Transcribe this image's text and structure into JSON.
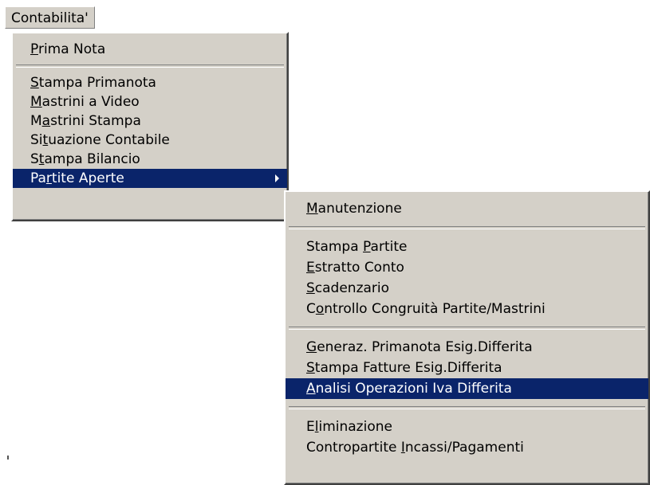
{
  "menubar": {
    "title": "Contabilita'"
  },
  "menu_main": {
    "items": [
      {
        "pre": "",
        "key": "P",
        "post": "rima Nota"
      },
      {
        "pre": "",
        "key": "S",
        "post": "tampa Primanota"
      },
      {
        "pre": "",
        "key": "M",
        "post": "astrini a Video"
      },
      {
        "pre": "M",
        "key": "a",
        "post": "strini Stampa"
      },
      {
        "pre": "Si",
        "key": "t",
        "post": "uazione Contabile"
      },
      {
        "pre": "S",
        "key": "t",
        "post": "ampa Bilancio"
      },
      {
        "pre": "Pa",
        "key": "r",
        "post": "tite Aperte"
      }
    ]
  },
  "submenu_partite": {
    "items": [
      {
        "pre": "",
        "key": "M",
        "post": "anutenzione"
      },
      {
        "pre": "Stampa ",
        "key": "P",
        "post": "artite"
      },
      {
        "pre": "",
        "key": "E",
        "post": "stratto Conto"
      },
      {
        "pre": "",
        "key": "S",
        "post": "cadenzario"
      },
      {
        "pre": "C",
        "key": "o",
        "post": "ntrollo Congruità Partite/Mastrini"
      },
      {
        "pre": "",
        "key": "G",
        "post": "eneraz. Primanota Esig.Differita"
      },
      {
        "pre": "",
        "key": "S",
        "post": "tampa Fatture Esig.Differita"
      },
      {
        "pre": "",
        "key": "A",
        "post": "nalisi Operazioni Iva Differita"
      },
      {
        "pre": "E",
        "key": "l",
        "post": "iminazione"
      },
      {
        "pre": "Contropartite ",
        "key": "I",
        "post": "ncassi/Pagamenti"
      }
    ]
  },
  "colors": {
    "menu_bg": "#d4d0c8",
    "highlight": "#0a246a",
    "highlight_text": "#ffffff"
  }
}
